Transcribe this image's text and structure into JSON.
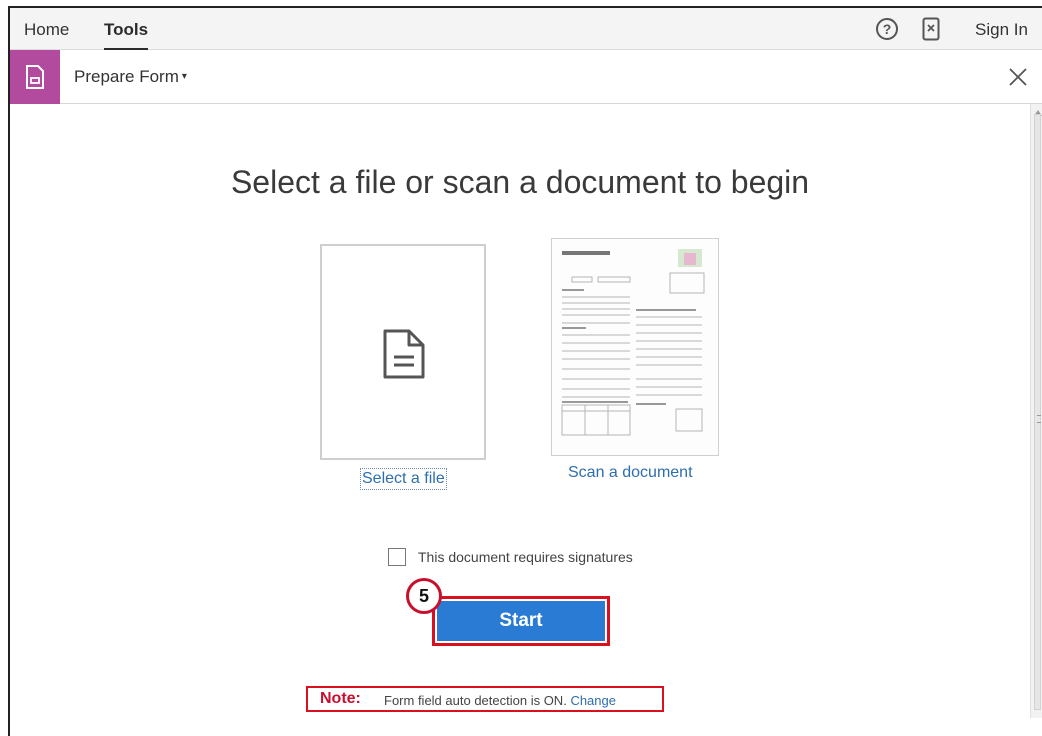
{
  "menubar": {
    "home": "Home",
    "tools": "Tools",
    "help_icon": "?",
    "sign_in": "Sign In",
    "icons": [
      "help-icon",
      "mobile-link-icon"
    ]
  },
  "toolbar": {
    "tool_name": "Prepare Form",
    "caret": "▾",
    "tool_color": "#b24a9e",
    "icons": [
      "prepare-form-icon",
      "close-icon"
    ]
  },
  "main": {
    "headline": "Select a file or scan a document to begin",
    "select_file_label": "Select a file",
    "scan_document_label": "Scan a document",
    "signatures_checkbox": {
      "label": "This document requires signatures",
      "checked": false
    },
    "step_number": "5",
    "start_label": "Start",
    "start_color": "#2a7bd3",
    "highlight_color": "#d9111f",
    "note": {
      "label": "Note:",
      "text": "Form field auto detection is ON.",
      "change_label": "Change"
    }
  }
}
